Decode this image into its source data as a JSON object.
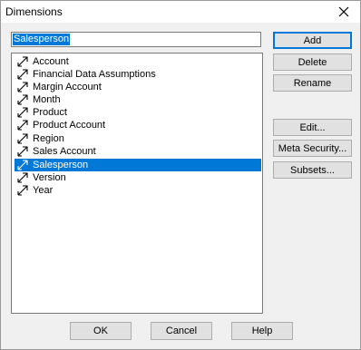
{
  "window": {
    "title": "Dimensions"
  },
  "name_field": {
    "value": "Salesperson"
  },
  "dimensions": {
    "items": [
      {
        "label": "Account"
      },
      {
        "label": "Financial Data Assumptions"
      },
      {
        "label": "Margin Account"
      },
      {
        "label": "Month"
      },
      {
        "label": "Product"
      },
      {
        "label": "Product Account"
      },
      {
        "label": "Region"
      },
      {
        "label": "Sales Account"
      },
      {
        "label": "Salesperson"
      },
      {
        "label": "Version"
      },
      {
        "label": "Year"
      }
    ],
    "selected": "Salesperson"
  },
  "side_buttons": {
    "add": "Add",
    "delete": "Delete",
    "rename": "Rename",
    "edit": "Edit...",
    "meta_security": "Meta Security...",
    "subsets": "Subsets..."
  },
  "footer_buttons": {
    "ok": "OK",
    "cancel": "Cancel",
    "help": "Help"
  },
  "colors": {
    "selection": "#0078d7",
    "button_face": "#e1e1e1"
  }
}
